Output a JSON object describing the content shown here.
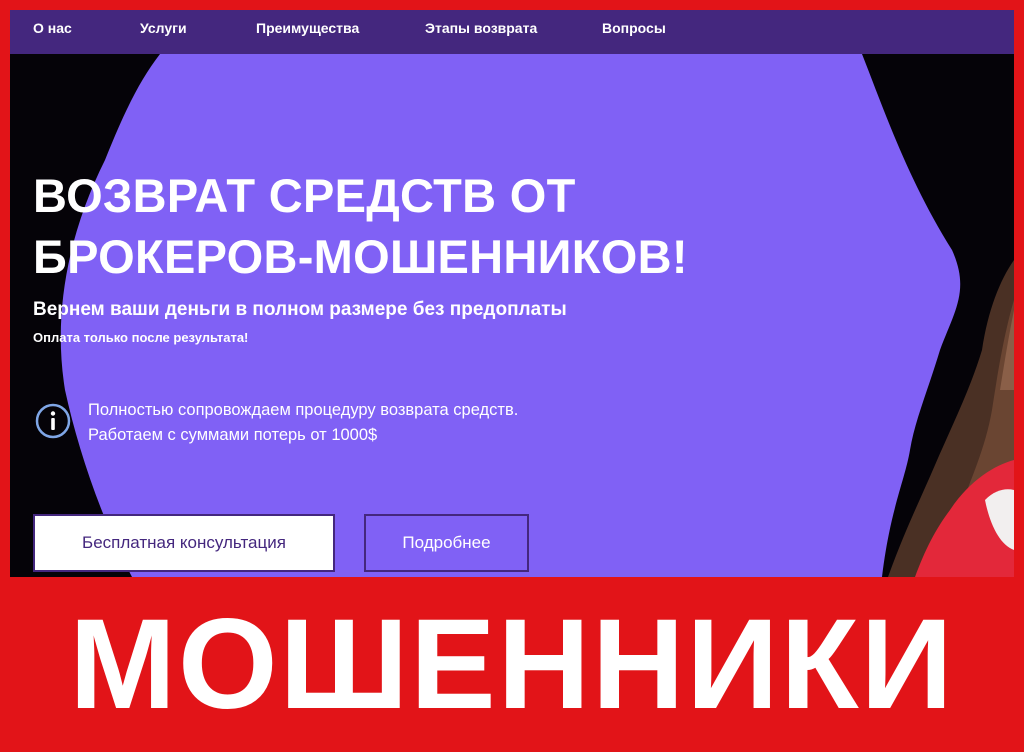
{
  "nav": {
    "items": [
      {
        "label": "О нас"
      },
      {
        "label": "Услуги"
      },
      {
        "label": "Преимущества"
      },
      {
        "label": "Этапы возврата"
      },
      {
        "label": "Вопросы"
      }
    ]
  },
  "hero": {
    "title_line1": "ВОЗВРАТ СРЕДСТВ ОТ",
    "title_line2": "БРОКЕРОВ-МОШЕННИКОВ!",
    "subtitle": "Вернем ваши деньги в полном размере без предоплаты",
    "note": "Оплата только после результата!",
    "info_icon": "info-circle-icon",
    "info_line1": "Полностью сопровождаем процедуру возврата средств.",
    "info_line2": "Работаем с суммами потерь от 1000$",
    "primary_button": "Бесплатная консультация",
    "secondary_button": "Подробнее"
  },
  "banner": {
    "label": "МОШЕННИКИ"
  },
  "colors": {
    "nav_bg": "#44277e",
    "hero_purple": "#8061f5",
    "page_bg": "#050308",
    "frame_red": "#e21418",
    "icon_blue": "#7fa6e6"
  }
}
